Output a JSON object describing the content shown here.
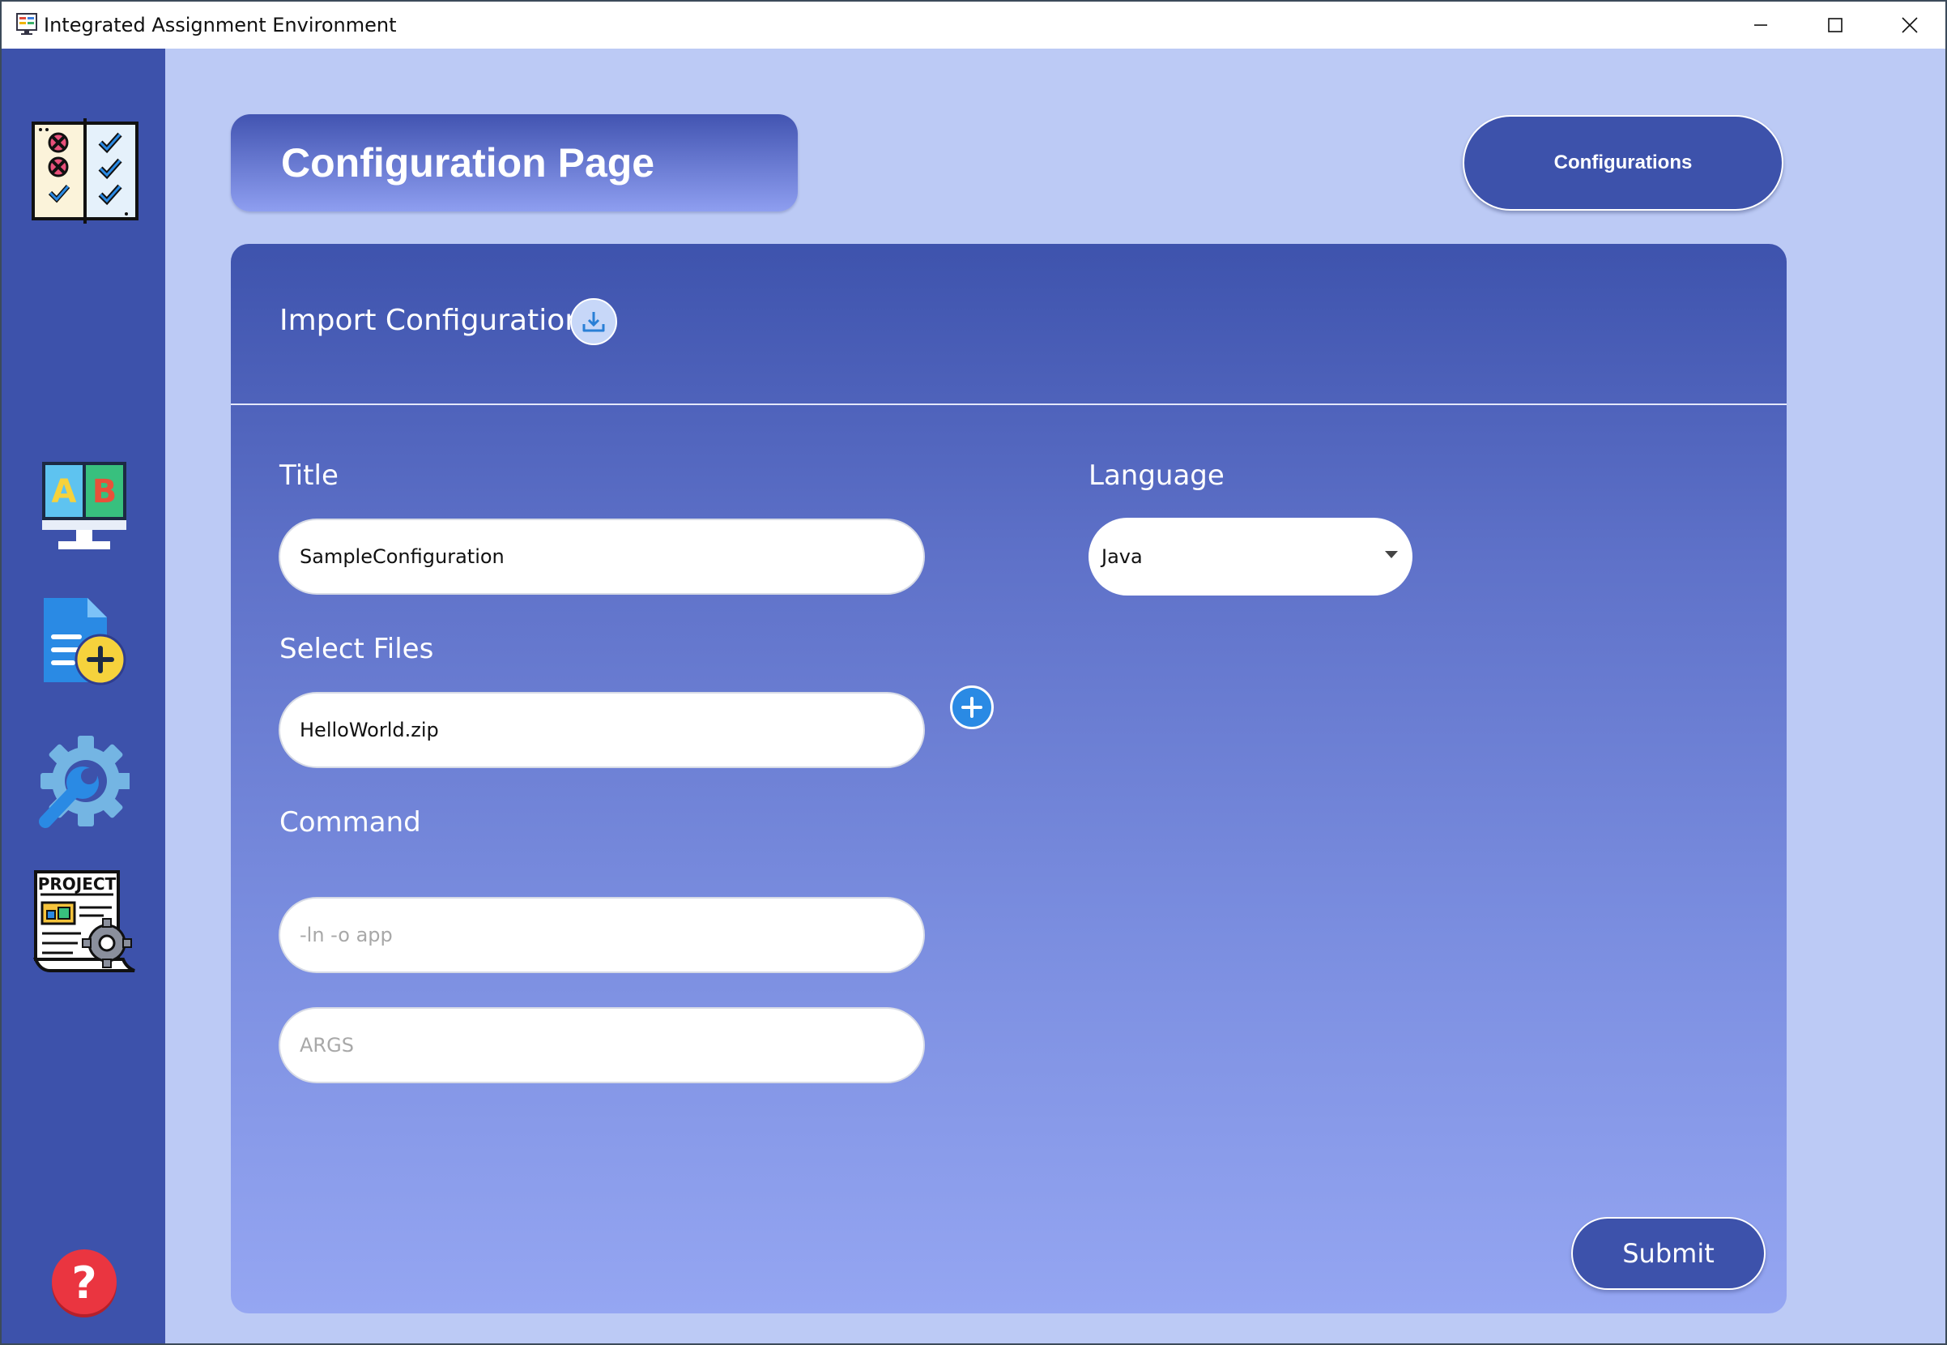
{
  "window": {
    "title": "Integrated Assignment Environment",
    "controls": {
      "minimize_icon": "minimize-icon",
      "maximize_icon": "maximize-icon",
      "close_icon": "close-icon"
    }
  },
  "sidebar": {
    "logo_icon": "checklist-icon",
    "items": [
      {
        "name": "ab-monitor-icon"
      },
      {
        "name": "new-document-icon"
      },
      {
        "name": "settings-wrench-icon"
      },
      {
        "name": "project-icon",
        "label": "PROJECT"
      }
    ],
    "help_icon": "help-icon",
    "help_glyph": "?"
  },
  "header": {
    "page_title": "Configuration Page",
    "configurations_button": "Configurations"
  },
  "import": {
    "label": "Import Configuration",
    "icon": "download-icon"
  },
  "form": {
    "title_label": "Title",
    "title_value": "SampleConfiguration",
    "language_label": "Language",
    "language_value": "Java",
    "files_label": "Select Files",
    "files_value": "HelloWorld.zip",
    "add_file_icon": "plus-icon",
    "command_label": "Command",
    "command_placeholder": "-ln -o app",
    "args_placeholder": "ARGS",
    "submit_label": "Submit"
  },
  "colors": {
    "sidebar": "#3d52ab",
    "background": "#bccaf5",
    "accent": "#2a8ae4",
    "help": "#e8323c"
  }
}
